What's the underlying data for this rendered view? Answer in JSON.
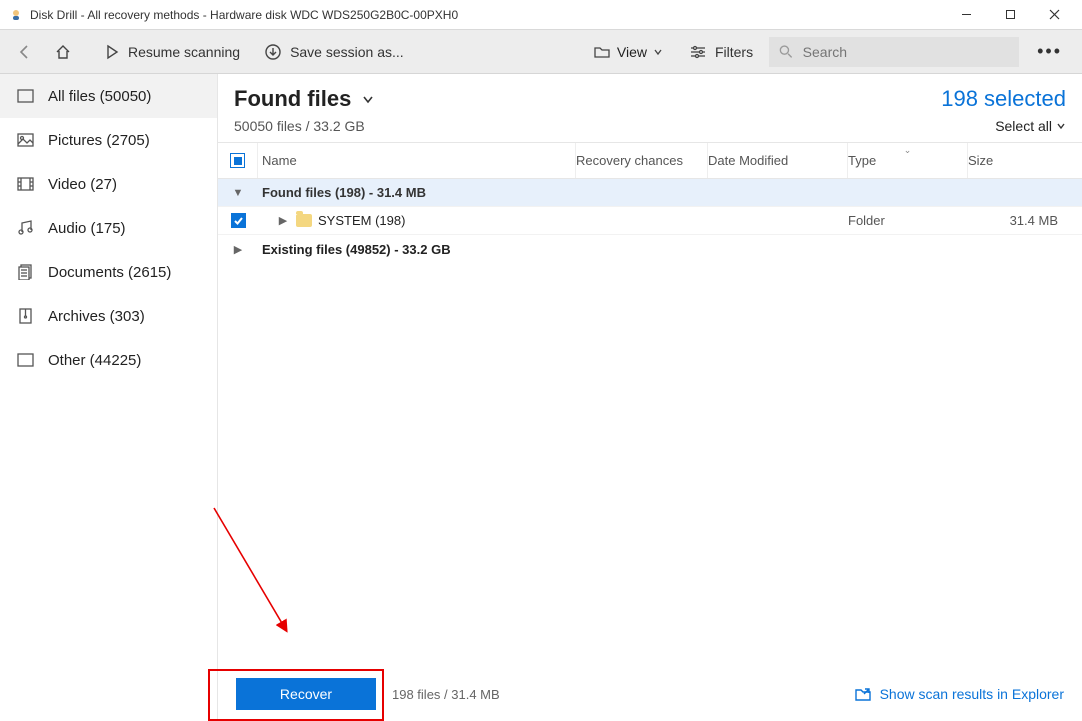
{
  "window": {
    "title": "Disk Drill - All recovery methods - Hardware disk WDC WDS250G2B0C-00PXH0"
  },
  "toolbar": {
    "resume": "Resume scanning",
    "save_session": "Save session as...",
    "view": "View",
    "filters": "Filters",
    "search_placeholder": "Search"
  },
  "sidebar": {
    "items": [
      {
        "label": "All files (50050)"
      },
      {
        "label": "Pictures (2705)"
      },
      {
        "label": "Video (27)"
      },
      {
        "label": "Audio (175)"
      },
      {
        "label": "Documents (2615)"
      },
      {
        "label": "Archives (303)"
      },
      {
        "label": "Other (44225)"
      }
    ]
  },
  "content": {
    "title": "Found files",
    "subtitle": "50050 files / 33.2 GB",
    "selected_text": "198 selected",
    "select_all": "Select all"
  },
  "columns": {
    "name": "Name",
    "recovery": "Recovery chances",
    "date": "Date Modified",
    "type": "Type",
    "size": "Size"
  },
  "rows": {
    "group_found": "Found files (198) - 31.4 MB",
    "system": {
      "name": "SYSTEM (198)",
      "type": "Folder",
      "size": "31.4 MB"
    },
    "group_existing": "Existing files (49852) - 33.2 GB"
  },
  "footer": {
    "recover": "Recover",
    "info": "198 files / 31.4 MB",
    "explorer": "Show scan results in Explorer"
  }
}
